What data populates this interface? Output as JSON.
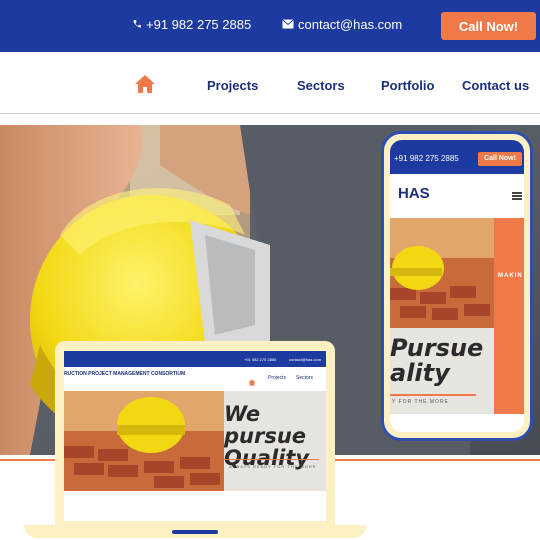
{
  "topbar": {
    "phone": "+91 982 275 2885",
    "email": "contact@has.com",
    "call_label": "Call Now!",
    "phone_icon": "phone-icon",
    "mail_icon": "envelope-icon"
  },
  "nav": {
    "home_icon": "home-icon",
    "items": [
      "Projects",
      "Sectors",
      "Portfolio",
      "Contact us"
    ]
  },
  "laptop": {
    "phone": "+91 982 275 2885",
    "email": "contact@has.com",
    "brand": "RUCTION PROJECT MANAGEMENT CONSORTIUM",
    "nav": [
      "Projects",
      "Sectors"
    ],
    "headline_1": "We pursue",
    "headline_2": "Quality",
    "tagline": "ALWAYS READY FOR THE MORE"
  },
  "phone_mock": {
    "phone": "+91 982 275 2885",
    "call_label": "Call Now!",
    "logo": "HAS",
    "headline_1": "Pursue",
    "headline_2": "ality",
    "tagline": "Y FOR THE MORE",
    "side_text": "MAKIN"
  },
  "colors": {
    "brand_blue": "#1c3a9f",
    "accent_orange": "#f0794a",
    "helmet_yellow": "#f5dd1a",
    "device_cream": "#fdf0c2"
  }
}
